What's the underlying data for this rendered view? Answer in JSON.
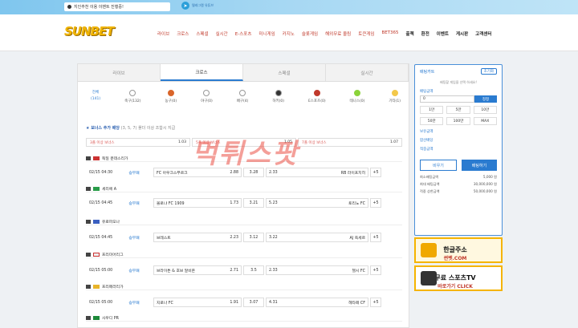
{
  "topbar": {
    "notice": "지인추천 이용 이벤트 진행중!",
    "telegram_label": "텔레그램 유튜브"
  },
  "header": {
    "logo": "SUNBET",
    "nav": [
      "라이브",
      "크로스",
      "스페셜",
      "실시간",
      "E-스포츠",
      "미니게임",
      "카지노",
      "슬롯게임",
      "해외무료 올림",
      "토큰게임",
      "BET365",
      "출첵",
      "환전",
      "이벤트",
      "게시판",
      "고객센터"
    ]
  },
  "tabs": [
    "라이브",
    "크로스",
    "스페셜",
    "실시간"
  ],
  "sports": [
    {
      "name": "전체",
      "count": "(141)"
    },
    {
      "name": "축구",
      "count": "(132)"
    },
    {
      "name": "농구",
      "count": "(0)"
    },
    {
      "name": "야구",
      "count": "(0)"
    },
    {
      "name": "배구",
      "count": "(4)"
    },
    {
      "name": "하키",
      "count": "(0)"
    },
    {
      "name": "E스포츠",
      "count": "(0)"
    },
    {
      "name": "테니스",
      "count": "(0)"
    },
    {
      "name": "기타",
      "count": "(1)"
    }
  ],
  "bonus": {
    "title": "보너스 추가 배당",
    "subtitle": "(3, 5, 7) 폴더 이상 조합시 지급",
    "items": [
      {
        "label": "3폴 이상 보너스",
        "value": "1.03"
      },
      {
        "label": "5폴 이상 보너스",
        "value": "1.05"
      },
      {
        "label": "7폴 이상 보너스",
        "value": "1.07"
      }
    ]
  },
  "games": [
    {
      "league": "독일 분데스리가",
      "time": "02/15 04:30",
      "kind": "승무패",
      "home": "FC 아우크스부르크",
      "home_odds": "2.88",
      "draw": "3.28",
      "away": "RB 라이프치히",
      "away_odds": "2.33",
      "more": "+5"
    },
    {
      "league": "세리에 A",
      "time": "02/15 04:45",
      "kind": "승무패",
      "home": "볼로냐 FC 1909",
      "home_odds": "1.73",
      "draw": "3.21",
      "away": "토리노 FC",
      "away_odds": "5.23",
      "more": "+5"
    },
    {
      "league": "유로파모나",
      "time": "02/15 04:45",
      "kind": "승무패",
      "home": "브레스트",
      "home_odds": "2.23",
      "draw": "3.12",
      "away": "AJ 옥세르",
      "away_odds": "3.22",
      "more": "+5"
    },
    {
      "league": "프리미어리그",
      "time": "02/15 05:00",
      "kind": "승무패",
      "home": "브라이튼 & 호브 알비온",
      "home_odds": "2.71",
      "draw": "3.5",
      "away": "첼시 FC",
      "away_odds": "2.33",
      "more": "+5"
    },
    {
      "league": "프리메라리가",
      "time": "02/15 05:00",
      "kind": "승무패",
      "home": "지로나 FC",
      "home_odds": "1.91",
      "draw": "3.07",
      "away": "헤타페 CF",
      "away_odds": "4.31",
      "more": "+5"
    }
  ],
  "last_league": "사우디 PR",
  "watermark": "먹튀스팟",
  "betslip": {
    "title": "배팅카트",
    "reset": "초기화",
    "empty": "배팅할 게임을 선택 하세요!",
    "amount_label": "배팅금액",
    "amount_value": "0",
    "confirm": "정정",
    "chips": [
      "1만",
      "5만",
      "10만",
      "50만",
      "100만",
      "MAX"
    ],
    "lines": [
      "보유금액",
      "합산배당",
      "적중금액"
    ],
    "clear_btn": "비우기",
    "bet_btn": "배팅하기",
    "limits": [
      {
        "label": "최소배팅금액",
        "value": "5,000 원"
      },
      {
        "label": "최대 배팅금액",
        "value": "30,000,000 원"
      },
      {
        "label": "적중 상한금액",
        "value": "50,000,000 원"
      }
    ]
  },
  "ads": [
    {
      "line1": "한글주소",
      "line2": "썬벳.COM"
    },
    {
      "line1": "무료 스포츠TV",
      "line2": "바로가기 CLICK"
    }
  ]
}
